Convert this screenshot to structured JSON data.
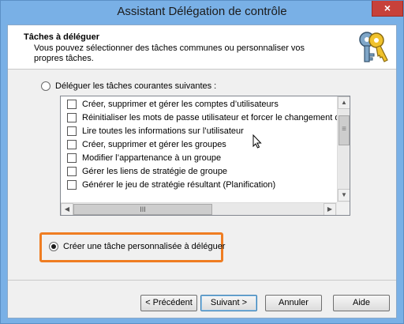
{
  "window": {
    "title": "Assistant Délégation de contrôle",
    "close_label": "×"
  },
  "header": {
    "title": "Tâches à déléguer",
    "description": "Vous pouvez sélectionner des tâches communes ou personnaliser vos propres tâches."
  },
  "options": {
    "common": {
      "label": "Déléguer les tâches courantes suivantes :",
      "selected": false
    },
    "custom": {
      "label": "Créer une tâche personnalisée à déléguer",
      "selected": true
    }
  },
  "tasks": [
    {
      "label": "Créer, supprimer et gérer les comptes d’utilisateurs",
      "checked": false
    },
    {
      "label": "Réinitialiser les mots de passe utilisateur et forcer le changement de mot de passe",
      "checked": false
    },
    {
      "label": "Lire toutes les informations sur l’utilisateur",
      "checked": false
    },
    {
      "label": "Créer, supprimer et gérer les groupes",
      "checked": false
    },
    {
      "label": "Modifier l’appartenance à un groupe",
      "checked": false
    },
    {
      "label": "Gérer les liens de stratégie de groupe",
      "checked": false
    },
    {
      "label": "Générer le jeu de stratégie résultant (Planification)",
      "checked": false
    }
  ],
  "scroll": {
    "up": "▲",
    "down": "▼",
    "left": "◀",
    "right": "▶",
    "thumb_grip": "III",
    "thumb_grip_v": "≡"
  },
  "buttons": {
    "back": "< Précédent",
    "next": "Suivant >",
    "cancel": "Annuler",
    "help": "Aide"
  },
  "colors": {
    "highlight": "#ef7d22",
    "titlebar": "#79b0e6",
    "close": "#c7413a"
  }
}
